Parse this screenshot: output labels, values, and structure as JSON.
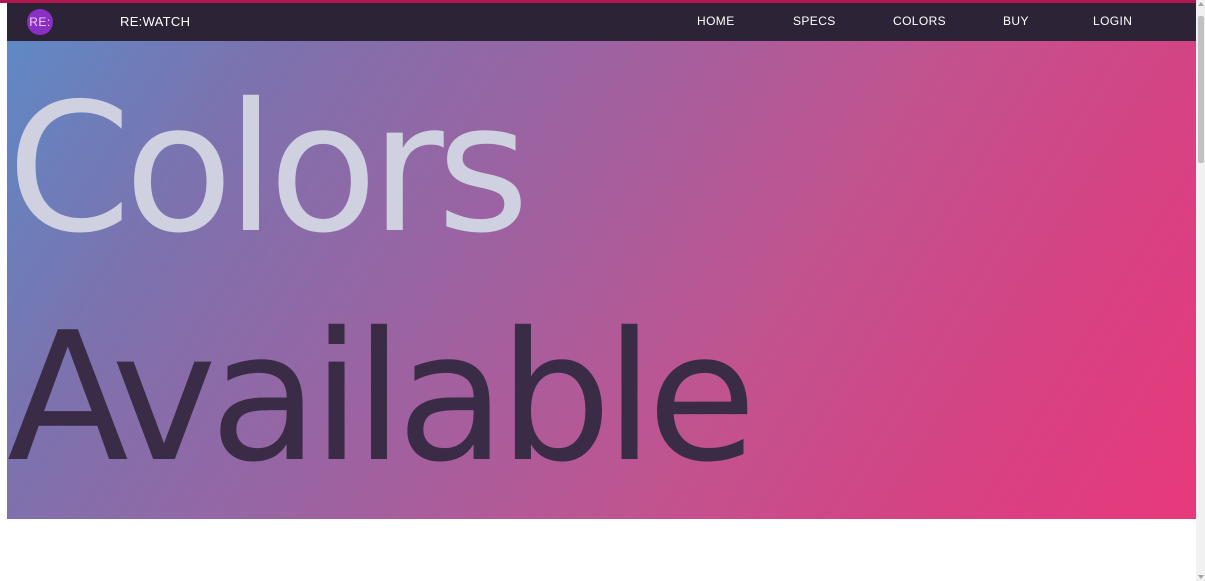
{
  "colors": {
    "accent_line": "#b2184f",
    "navbar_bg": "#2d2336",
    "logo_bg": "#8a2fc4"
  },
  "nav": {
    "logo_text": "RE:",
    "brand": "RE:WATCH",
    "links": [
      "HOME",
      "SPECS",
      "COLORS",
      "BUY",
      "LOGIN"
    ]
  },
  "hero": {
    "line1": "Colors",
    "line2": "Available"
  }
}
